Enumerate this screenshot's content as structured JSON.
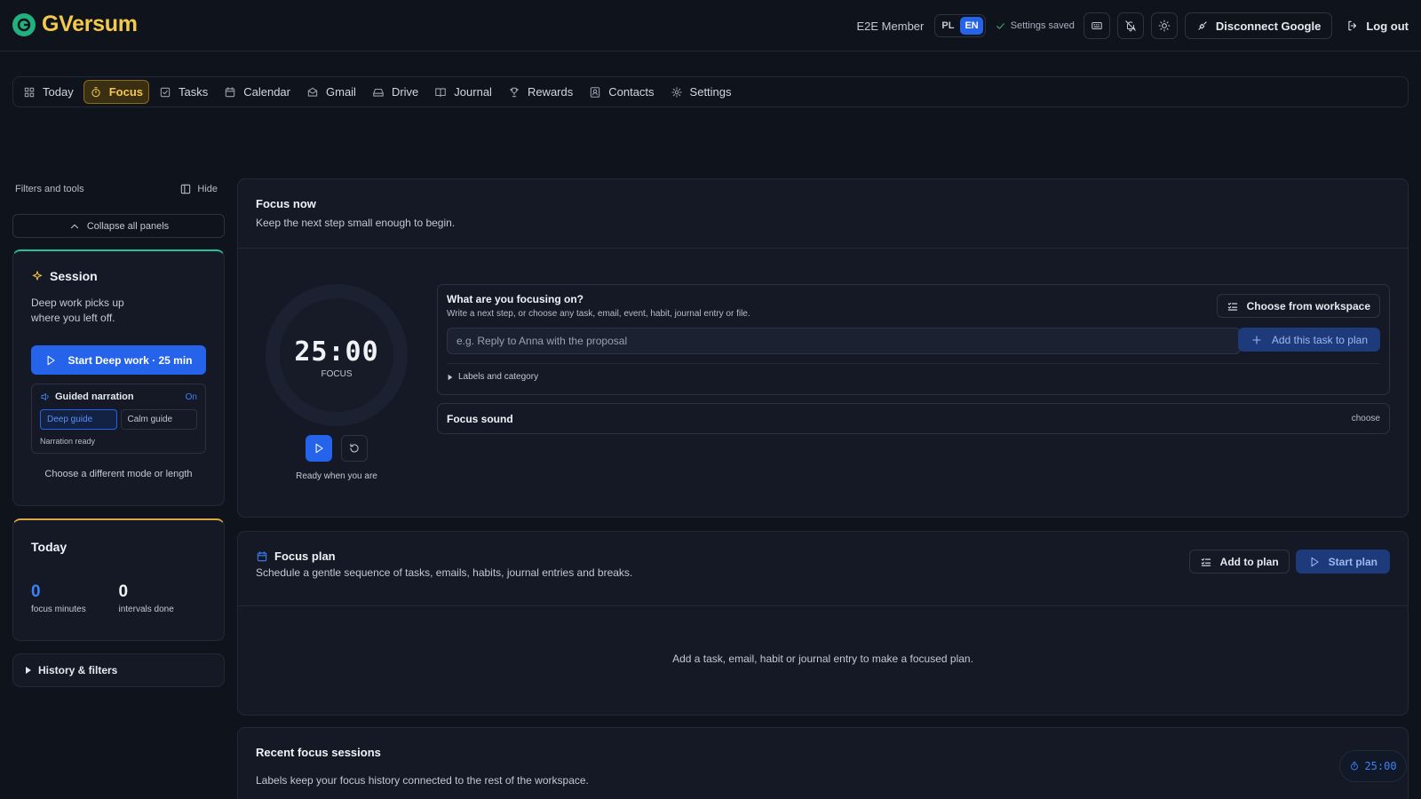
{
  "app": {
    "name": "GVersum"
  },
  "header": {
    "member": "E2E Member",
    "languages": [
      "PL",
      "EN"
    ],
    "active_language": "EN",
    "saved_status": "Settings saved",
    "disconnect": "Disconnect Google",
    "logout": "Log out"
  },
  "nav": {
    "items": [
      {
        "label": "Today",
        "icon": "grid-icon"
      },
      {
        "label": "Focus",
        "icon": "timer-icon"
      },
      {
        "label": "Tasks",
        "icon": "checkbox-icon"
      },
      {
        "label": "Calendar",
        "icon": "calendar-icon"
      },
      {
        "label": "Gmail",
        "icon": "mail-icon"
      },
      {
        "label": "Drive",
        "icon": "drive-icon"
      },
      {
        "label": "Journal",
        "icon": "book-icon"
      },
      {
        "label": "Rewards",
        "icon": "trophy-icon"
      },
      {
        "label": "Contacts",
        "icon": "contacts-icon"
      },
      {
        "label": "Settings",
        "icon": "gear-icon"
      }
    ],
    "active": "Focus"
  },
  "sidebar": {
    "heading": "Filters and tools",
    "hide": "Hide",
    "collapse": "Collapse all panels",
    "session": {
      "title": "Session",
      "description": "Deep work picks up where you left off.",
      "start_button": "Start Deep work · 25 min",
      "narration": {
        "title": "Guided narration",
        "state": "On",
        "options": [
          "Deep guide",
          "Calm guide"
        ],
        "selected": "Deep guide",
        "status": "Narration ready"
      },
      "mode_link": "Choose a different mode or length"
    },
    "today": {
      "title": "Today",
      "focus_minutes": "0",
      "focus_minutes_label": "focus minutes",
      "intervals": "0",
      "intervals_label": "intervals done"
    },
    "history": "History & filters"
  },
  "focus_now": {
    "title": "Focus now",
    "subtitle": "Keep the next step small enough to begin.",
    "timer": {
      "value": "25:00",
      "label": "FOCUS"
    },
    "ready": "Ready when you are",
    "prompt": {
      "title": "What are you focusing on?",
      "subtitle": "Write a next step, or choose any task, email, event, habit, journal entry or file.",
      "choose_button": "Choose from workspace",
      "input_placeholder": "e.g. Reply to Anna with the proposal",
      "input_value": "",
      "add_button": "Add this task to plan",
      "labels_toggle": "Labels and category"
    },
    "sound": {
      "label": "Focus sound",
      "action": "choose"
    }
  },
  "focus_plan": {
    "title": "Focus plan",
    "subtitle": "Schedule a gentle sequence of tasks, emails, habits, journal entries and breaks.",
    "add_button": "Add to plan",
    "start_button": "Start plan",
    "empty": "Add a task, email, habit or journal entry to make a focused plan."
  },
  "recent": {
    "title": "Recent focus sessions",
    "subtitle": "Labels keep your focus history connected to the rest of the workspace."
  },
  "mini_timer": "25:00",
  "colors": {
    "background": "#0f131c",
    "accent": "#2563eb",
    "brand": "#f3c84b",
    "session_accent": "#25c0a0",
    "today_accent": "#d9a644"
  }
}
